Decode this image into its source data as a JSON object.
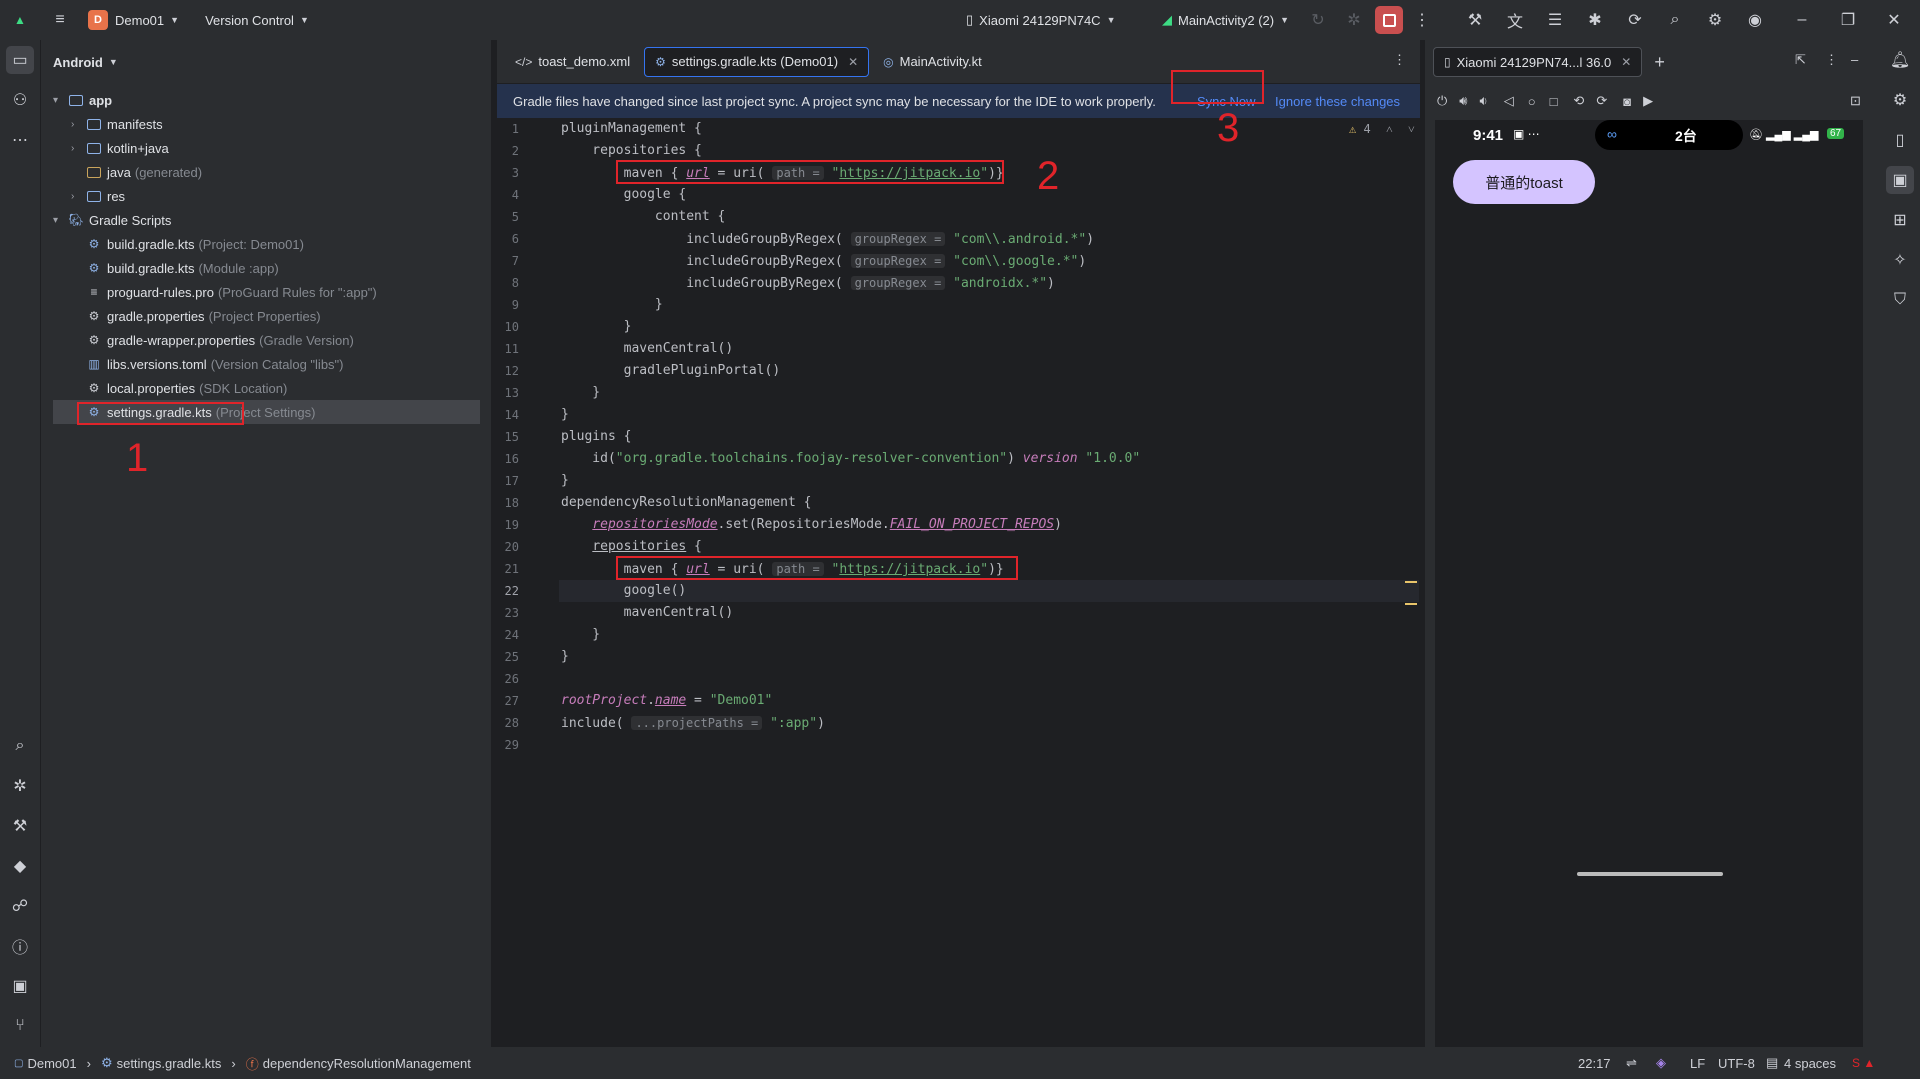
{
  "titlebar": {
    "project_badge": "D",
    "project_name": "Demo01",
    "vcs_label": "Version Control",
    "device_label": "Xiaomi 24129PN74C",
    "run_config": "MainActivity2 (2)"
  },
  "project_panel": {
    "view_label": "Android",
    "tree": [
      {
        "label": "app",
        "hint": ""
      },
      {
        "label": "manifests",
        "hint": ""
      },
      {
        "label": "kotlin+java",
        "hint": ""
      },
      {
        "label": "java",
        "hint": "(generated)"
      },
      {
        "label": "res",
        "hint": ""
      },
      {
        "label": "Gradle Scripts",
        "hint": ""
      },
      {
        "label": "build.gradle.kts",
        "hint": "(Project: Demo01)"
      },
      {
        "label": "build.gradle.kts",
        "hint": "(Module :app)"
      },
      {
        "label": "proguard-rules.pro",
        "hint": "(ProGuard Rules for \":app\")"
      },
      {
        "label": "gradle.properties",
        "hint": "(Project Properties)"
      },
      {
        "label": "gradle-wrapper.properties",
        "hint": "(Gradle Version)"
      },
      {
        "label": "libs.versions.toml",
        "hint": "(Version Catalog \"libs\")"
      },
      {
        "label": "local.properties",
        "hint": "(SDK Location)"
      },
      {
        "label": "settings.gradle.kts",
        "hint": "(Project Settings)"
      }
    ]
  },
  "editor": {
    "tabs": [
      "toast_demo.xml",
      "settings.gradle.kts (Demo01)",
      "MainActivity.kt"
    ],
    "banner_text": "Gradle files have changed since last project sync. A project sync may be necessary for the IDE to work properly.",
    "sync_now": "Sync Now",
    "ignore_changes": "Ignore these changes",
    "warning_count": "4",
    "line_numbers": [
      "1",
      "2",
      "3",
      "4",
      "5",
      "6",
      "7",
      "8",
      "9",
      "10",
      "11",
      "12",
      "13",
      "14",
      "15",
      "16",
      "17",
      "18",
      "19",
      "20",
      "21",
      "22",
      "23",
      "24",
      "25",
      "26",
      "27",
      "28",
      "29"
    ],
    "current_line": "22"
  },
  "annotations": {
    "one": "1",
    "two": "2",
    "three": "3"
  },
  "device_panel": {
    "tab_label": "Xiaomi 24129PN74...l 36.0",
    "phone_time": "9:41",
    "phone_count": "2台",
    "battery": "67",
    "toast_button": "普通的toast"
  },
  "statusbar": {
    "breadcrumb_project": "Demo01",
    "breadcrumb_file": "settings.gradle.kts",
    "breadcrumb_scope": "dependencyResolutionManagement",
    "position": "22:17",
    "line_sep": "LF",
    "encoding": "UTF-8",
    "indent": "4 spaces"
  },
  "colors": {
    "accent": "#3574f0",
    "annotation_red": "#e0242a",
    "string_green": "#6aab73",
    "banner_bg": "#25324d"
  }
}
